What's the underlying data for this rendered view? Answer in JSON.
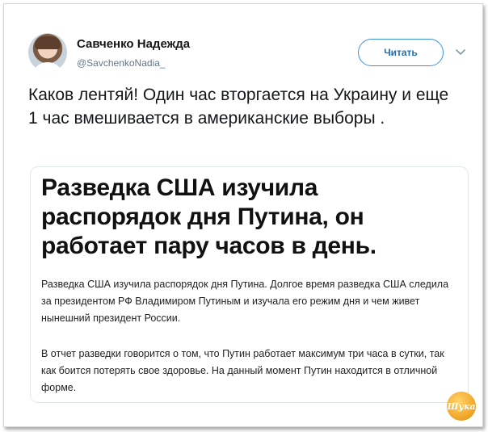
{
  "tweet": {
    "author_name": "Савченко Надежда",
    "author_handle": "@SavchenkoNadia_",
    "follow_label": "Читать",
    "text": "Каков лентяй! Один час вторгается на Украину и еще 1 час вмешивается в американские выборы ."
  },
  "card": {
    "headline": "Разведка США изучила распорядок дня Путина, он работает пару часов в день.",
    "paragraph1": "Разведка США изучила распорядок дня Путина. Долгое время разведка США следила за президентом РФ Владимиром Путиным и изучала его режим дня и чем живет нынешний президент России.",
    "paragraph2": "В отчет разведки говорится о том, что Путин работает максимум три часа в сутки, так как боится потерять свое здоровье. На данный момент Путин находится в отличной форме."
  },
  "watermark": {
    "text": "Шука"
  },
  "colors": {
    "accent": "#1b6fb5",
    "border": "#e1e8ed",
    "handle": "#657786"
  },
  "icons": {
    "menu": "chevron-down-icon",
    "avatar": "avatar"
  }
}
